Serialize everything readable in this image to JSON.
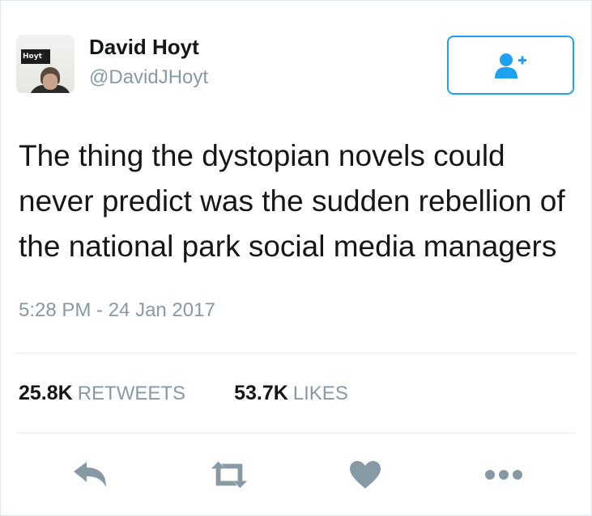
{
  "author": {
    "display_name": "David Hoyt",
    "handle": "@DavidJHoyt",
    "avatar_sign_text": "Hoyt"
  },
  "follow_button": {
    "icon": "follow-user-icon",
    "accent": "#1da1f2"
  },
  "tweet": {
    "text_line_1": "The thing the dystopian novels could",
    "text_line_2": "never predict was the sudden rebellion of",
    "text_line_3": "the national park social media managers",
    "timestamp": "5:28 PM - 24 Jan 2017"
  },
  "stats": {
    "retweets_count": "25.8K",
    "retweets_label": "RETWEETS",
    "likes_count": "53.7K",
    "likes_label": "LIKES"
  },
  "actions": {
    "icons": [
      "reply-icon",
      "retweet-icon",
      "like-icon",
      "more-icon"
    ],
    "icon_color": "#8899a6"
  },
  "colors": {
    "text": "#14171a",
    "muted": "#8899a6",
    "divider": "#e1e8ed"
  }
}
